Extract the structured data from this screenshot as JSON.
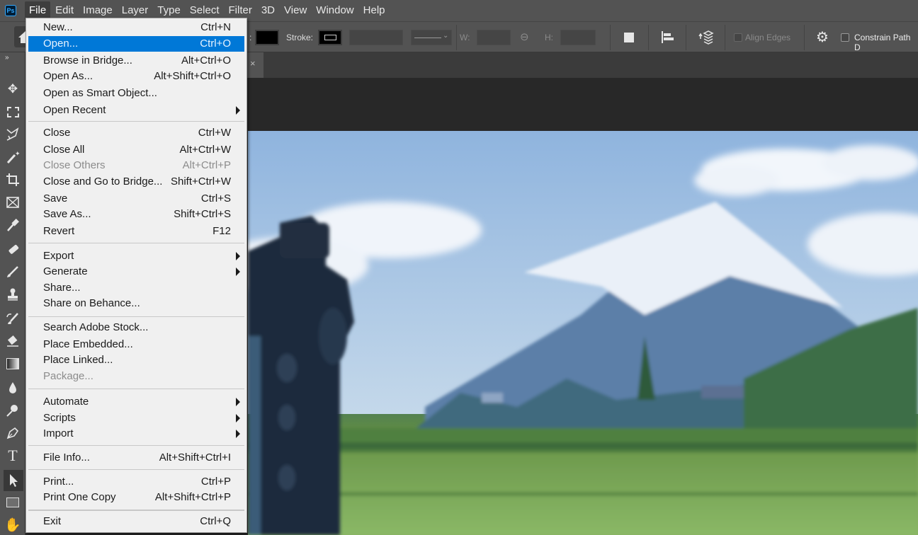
{
  "app": {
    "logo": "Ps"
  },
  "menubar": {
    "items": [
      "File",
      "Edit",
      "Image",
      "Layer",
      "Type",
      "Select",
      "Filter",
      "3D",
      "View",
      "Window",
      "Help"
    ],
    "active": "File"
  },
  "options": {
    "fill_label_tail": ":",
    "stroke_label": "Stroke:",
    "width_label": "W:",
    "height_label": "H:",
    "align_edges": "Align Edges",
    "constrain": "Constrain Path D"
  },
  "toolbar": {
    "collapse": "»",
    "tools": [
      "move-tool",
      "rectangular-marquee-tool",
      "lasso-tool",
      "magic-wand-tool",
      "crop-tool",
      "frame-tool",
      "eyedropper-tool",
      "healing-brush-tool",
      "brush-tool",
      "clone-stamp-tool",
      "history-brush-tool",
      "eraser-tool",
      "gradient-tool",
      "blur-tool",
      "dodge-tool",
      "pen-tool",
      "type-tool",
      "path-selection-tool",
      "rectangle-tool",
      "hand-tool"
    ],
    "active": "path-selection-tool"
  },
  "document_tab": {
    "modified": "*",
    "close": "×"
  },
  "file_menu": {
    "groups": [
      [
        {
          "label": "New...",
          "shortcut": "Ctrl+N"
        },
        {
          "label": "Open...",
          "shortcut": "Ctrl+O",
          "highlighted": true
        },
        {
          "label": "Browse in Bridge...",
          "shortcut": "Alt+Ctrl+O"
        },
        {
          "label": "Open As...",
          "shortcut": "Alt+Shift+Ctrl+O"
        },
        {
          "label": "Open as Smart Object...",
          "shortcut": ""
        },
        {
          "label": "Open Recent",
          "shortcut": "",
          "submenu": true
        }
      ],
      [
        {
          "label": "Close",
          "shortcut": "Ctrl+W"
        },
        {
          "label": "Close All",
          "shortcut": "Alt+Ctrl+W"
        },
        {
          "label": "Close Others",
          "shortcut": "Alt+Ctrl+P",
          "disabled": true
        },
        {
          "label": "Close and Go to Bridge...",
          "shortcut": "Shift+Ctrl+W"
        },
        {
          "label": "Save",
          "shortcut": "Ctrl+S"
        },
        {
          "label": "Save As...",
          "shortcut": "Shift+Ctrl+S"
        },
        {
          "label": "Revert",
          "shortcut": "F12"
        }
      ],
      [
        {
          "label": "Export",
          "shortcut": "",
          "submenu": true
        },
        {
          "label": "Generate",
          "shortcut": "",
          "submenu": true
        },
        {
          "label": "Share...",
          "shortcut": ""
        },
        {
          "label": "Share on Behance...",
          "shortcut": ""
        }
      ],
      [
        {
          "label": "Search Adobe Stock...",
          "shortcut": ""
        },
        {
          "label": "Place Embedded...",
          "shortcut": ""
        },
        {
          "label": "Place Linked...",
          "shortcut": ""
        },
        {
          "label": "Package...",
          "shortcut": "",
          "disabled": true
        }
      ],
      [
        {
          "label": "Automate",
          "shortcut": "",
          "submenu": true
        },
        {
          "label": "Scripts",
          "shortcut": "",
          "submenu": true
        },
        {
          "label": "Import",
          "shortcut": "",
          "submenu": true
        }
      ],
      [
        {
          "label": "File Info...",
          "shortcut": "Alt+Shift+Ctrl+I"
        }
      ],
      [
        {
          "label": "Print...",
          "shortcut": "Ctrl+P"
        },
        {
          "label": "Print One Copy",
          "shortcut": "Alt+Shift+Ctrl+P"
        }
      ],
      [
        {
          "label": "Exit",
          "shortcut": "Ctrl+Q"
        }
      ]
    ]
  },
  "colors": {
    "highlight": "#0078d7",
    "menubar": "#535353",
    "menu_bg": "#f0f0f0"
  }
}
